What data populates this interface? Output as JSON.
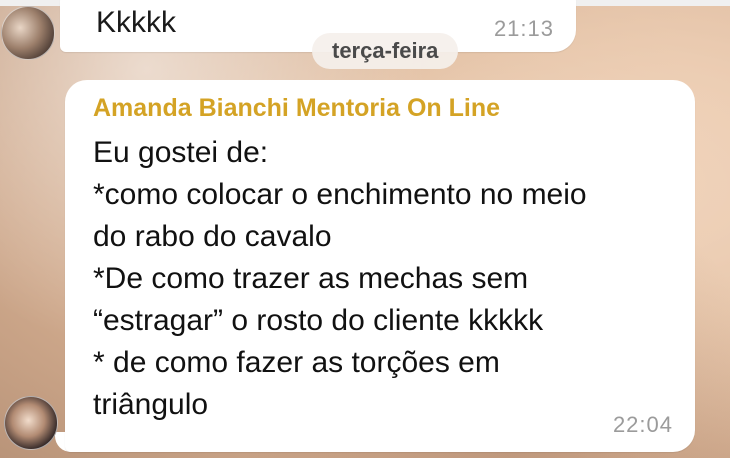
{
  "chat": {
    "previous_message": {
      "text": "Kkkkk",
      "time": "21:13"
    },
    "date_separator": "terça-feira",
    "message": {
      "sender": "Amanda Bianchi Mentoria On Line",
      "lines": [
        "Eu gostei de:",
        "*como colocar o enchimento no meio",
        "do rabo do cavalo",
        "*De como trazer as mechas sem",
        "“estragar” o rosto do cliente kkkkk",
        "* de como fazer as torções em",
        "triângulo"
      ],
      "time": "22:04"
    }
  },
  "colors": {
    "sender_name": "#d4a325",
    "bubble": "#ffffff",
    "timestamp": "#9b9b9b"
  }
}
